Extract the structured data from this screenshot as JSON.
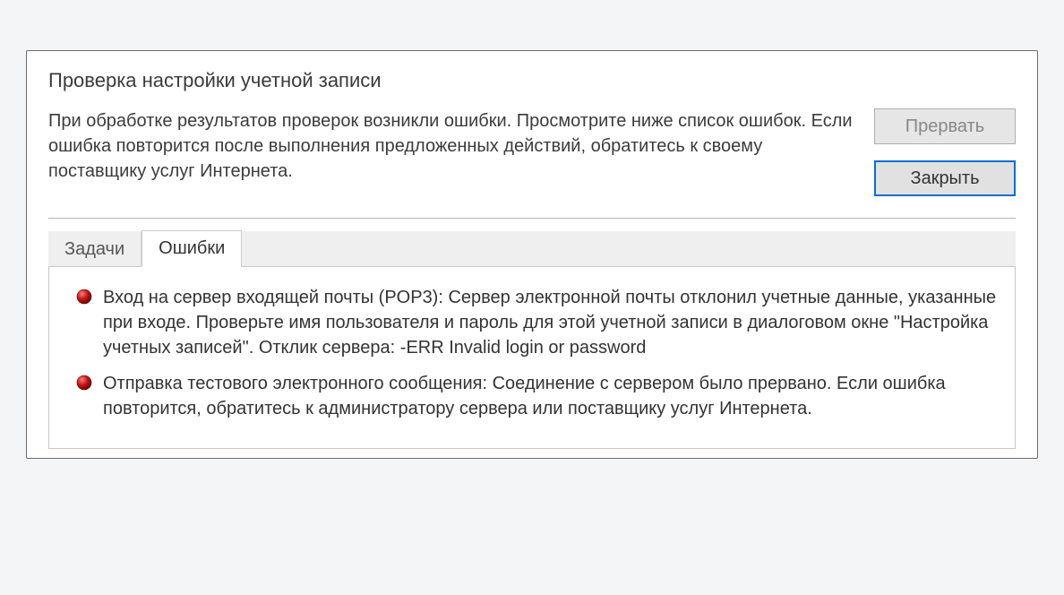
{
  "dialog": {
    "title": "Проверка настройки учетной записи",
    "description": "При обработке результатов проверок возникли ошибки. Просмотрите ниже список ошибок. Если ошибка повторится после выполнения предложенных действий, обратитесь к своему поставщику услуг Интернета.",
    "buttons": {
      "stop": "Прервать",
      "close": "Закрыть"
    },
    "tabs": {
      "tasks": "Задачи",
      "errors": "Ошибки"
    },
    "errors": [
      "Вход на сервер входящей почты (POP3): Сервер электронной почты отклонил учетные данные, указанные при входе. Проверьте имя пользователя и пароль для этой учетной записи в диалоговом окне \"Настройка учетных записей\".  Отклик сервера: -ERR Invalid login or password",
      "Отправка тестового электронного сообщения: Соединение с сервером было прервано. Если ошибка повторится, обратитесь к администратору сервера или поставщику услуг Интернета."
    ]
  }
}
